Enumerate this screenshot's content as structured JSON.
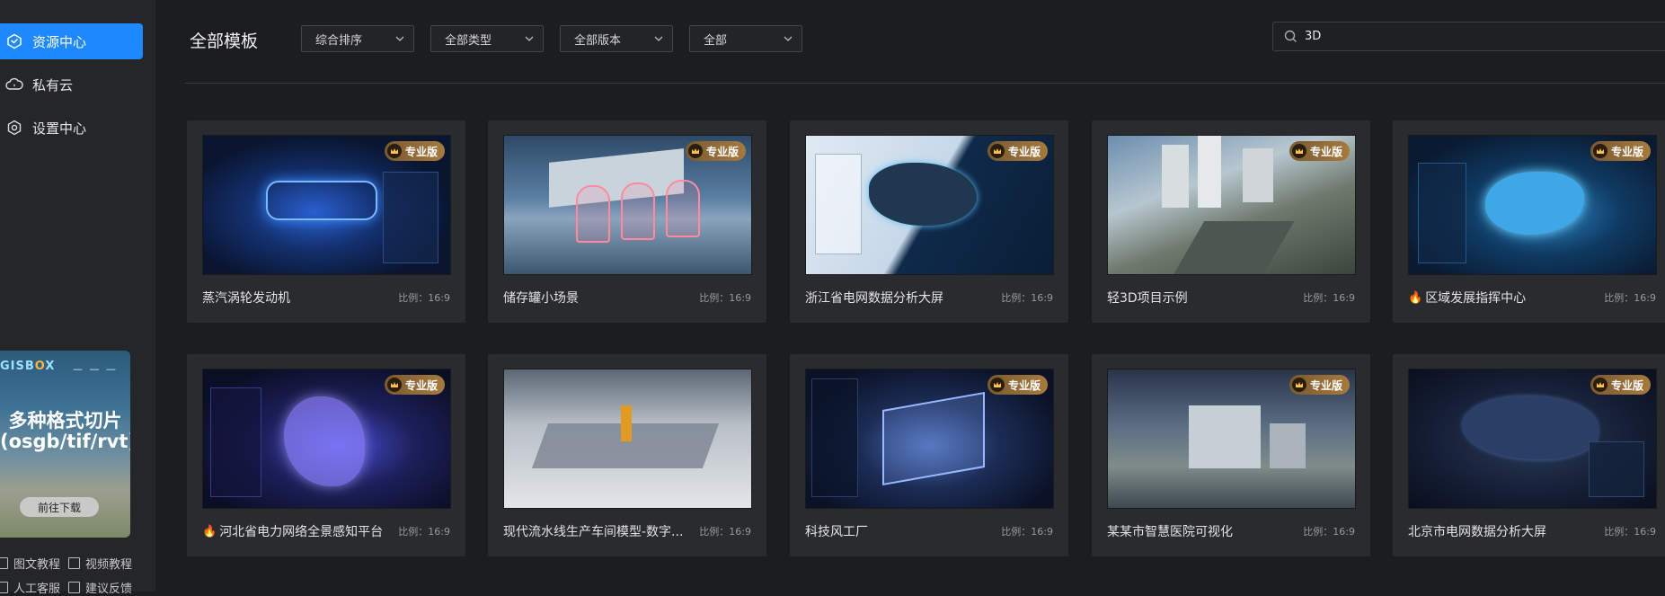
{
  "sidebar": {
    "items": [
      {
        "label": "资源中心",
        "icon": "cube-icon",
        "active": true
      },
      {
        "label": "私有云",
        "icon": "cloud-icon",
        "active": false
      },
      {
        "label": "设置中心",
        "icon": "gear-icon",
        "active": false
      }
    ],
    "promo": {
      "logo": "GISB",
      "logo_o": "O",
      "logo_x": "X",
      "line1": "多种格式切片",
      "line2": "(osgb/tif/rvt)",
      "button": "前往下载"
    },
    "links": [
      {
        "label": "图文教程"
      },
      {
        "label": "视频教程"
      },
      {
        "label": "人工客服"
      },
      {
        "label": "建议反馈"
      }
    ]
  },
  "header": {
    "title": "全部模板",
    "filters": [
      {
        "value": "综合排序"
      },
      {
        "value": "全部类型"
      },
      {
        "value": "全部版本"
      },
      {
        "value": "全部"
      }
    ],
    "search_value": "3D"
  },
  "badge_label": "专业版",
  "cards": [
    {
      "name": "蒸汽涡轮发动机",
      "ratio": "比例：16:9",
      "badge": true,
      "hot": false
    },
    {
      "name": "储存罐小场景",
      "ratio": "比例：16:9",
      "badge": true,
      "hot": false
    },
    {
      "name": "浙江省电网数据分析大屏",
      "ratio": "比例：16:9",
      "badge": true,
      "hot": false
    },
    {
      "name": "轻3D项目示例",
      "ratio": "比例：16:9",
      "badge": true,
      "hot": false
    },
    {
      "name": "区域发展指挥中心",
      "ratio": "比例：16:9",
      "badge": true,
      "hot": true
    },
    {
      "name": "河北省电力网络全景感知平台",
      "ratio": "比例：16:9",
      "badge": true,
      "hot": true
    },
    {
      "name": "现代流水线生产车间模型-数字...",
      "ratio": "比例：16:9",
      "badge": false,
      "hot": false
    },
    {
      "name": "科技风工厂",
      "ratio": "比例：16:9",
      "badge": true,
      "hot": false
    },
    {
      "name": "某某市智慧医院可视化",
      "ratio": "比例：16:9",
      "badge": true,
      "hot": false
    },
    {
      "name": "北京市电网数据分析大屏",
      "ratio": "比例：16:9",
      "badge": true,
      "hot": false
    }
  ],
  "colors": {
    "accent": "#1e88ff",
    "badge": "#a77a3d",
    "hot": "#ff6a2a"
  }
}
